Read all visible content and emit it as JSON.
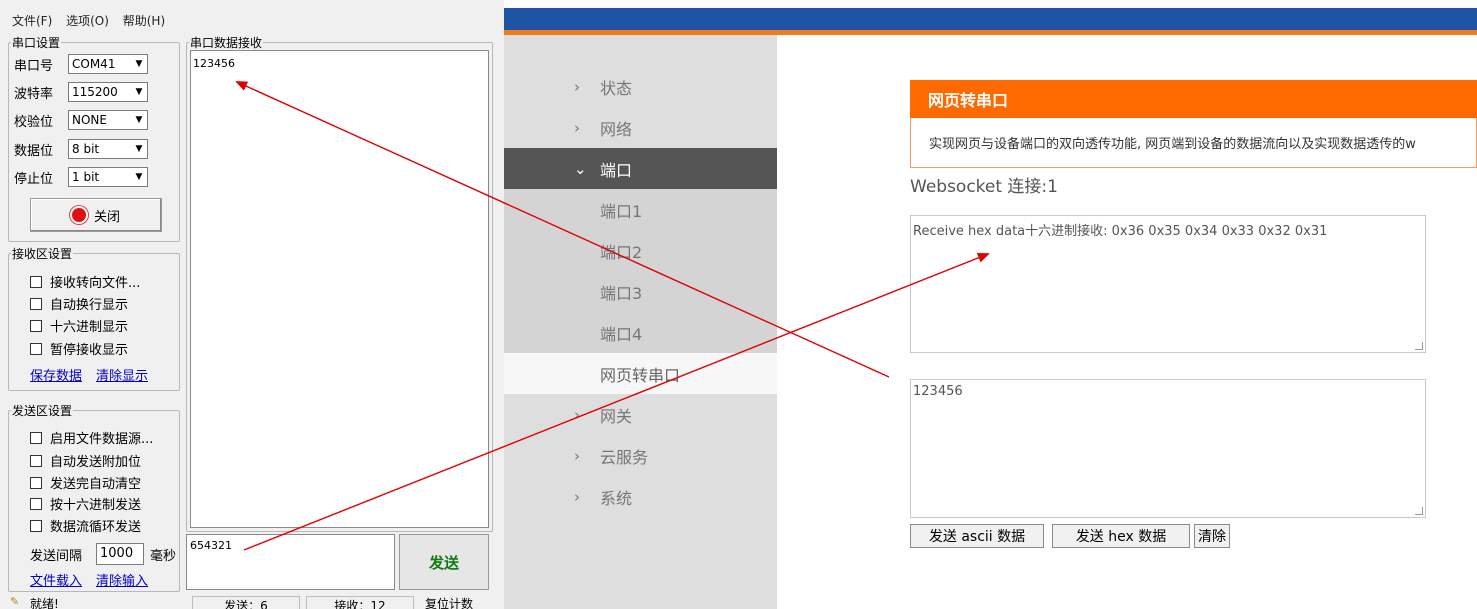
{
  "serial_tool": {
    "menu": [
      "文件(F)",
      "选项(O)",
      "帮助(H)"
    ],
    "port_group": {
      "title": "串口设置",
      "fields": [
        {
          "label": "串口号",
          "value": "COM41"
        },
        {
          "label": "波特率",
          "value": "115200"
        },
        {
          "label": "校验位",
          "value": "NONE"
        },
        {
          "label": "数据位",
          "value": "8 bit"
        },
        {
          "label": "停止位",
          "value": "1 bit"
        }
      ],
      "close_button": "关闭"
    },
    "receive_settings": {
      "title": "接收区设置",
      "options": [
        "接收转向文件...",
        "自动换行显示",
        "十六进制显示",
        "暂停接收显示"
      ],
      "save_link": "保存数据",
      "clear_link": "清除显示"
    },
    "send_settings": {
      "title": "发送区设置",
      "options": [
        "启用文件数据源...",
        "自动发送附加位",
        "发送完自动清空",
        "按十六进制发送",
        "数据流循环发送"
      ],
      "interval_label": "发送间隔",
      "interval_value": "1000",
      "interval_unit": "毫秒",
      "load_file_link": "文件载入",
      "clear_input_link": "清除输入"
    },
    "receive_area": {
      "title": "串口数据接收",
      "content": "123456"
    },
    "send_area": {
      "content": "654321"
    },
    "send_button": "发送",
    "statusbar": {
      "ready": "就绪!",
      "sent": "发送：6",
      "received": "接收：12",
      "reset": "复位计数"
    }
  },
  "web_page": {
    "colors": {
      "topbar": "#1e54a4",
      "accent": "#ff6a00",
      "nav_bg": "#dedede",
      "nav_active": "#555555"
    },
    "nav": [
      {
        "label": "状态",
        "type": "group"
      },
      {
        "label": "网络",
        "type": "group"
      },
      {
        "label": "端口",
        "type": "group-open"
      },
      {
        "label": "端口1",
        "type": "sub"
      },
      {
        "label": "端口2",
        "type": "sub"
      },
      {
        "label": "端口3",
        "type": "sub"
      },
      {
        "label": "端口4",
        "type": "sub"
      },
      {
        "label": "网页转串口",
        "type": "sub-selected"
      },
      {
        "label": "网关",
        "type": "group"
      },
      {
        "label": "云服务",
        "type": "group"
      },
      {
        "label": "系统",
        "type": "group"
      }
    ],
    "panel": {
      "title": "网页转串口",
      "description": "实现网页与设备端口的双向透传功能, 网页端到设备的数据流向以及实现数据透传的w",
      "ws_status": "Websocket 连接:1",
      "receive_text": "Receive hex data十六进制接收: 0x36 0x35 0x34 0x33 0x32 0x31",
      "send_text": "123456",
      "buttons": {
        "send_ascii": "发送 ascii 数据",
        "send_hex": "发送 hex 数据",
        "clear": "清除"
      }
    }
  }
}
